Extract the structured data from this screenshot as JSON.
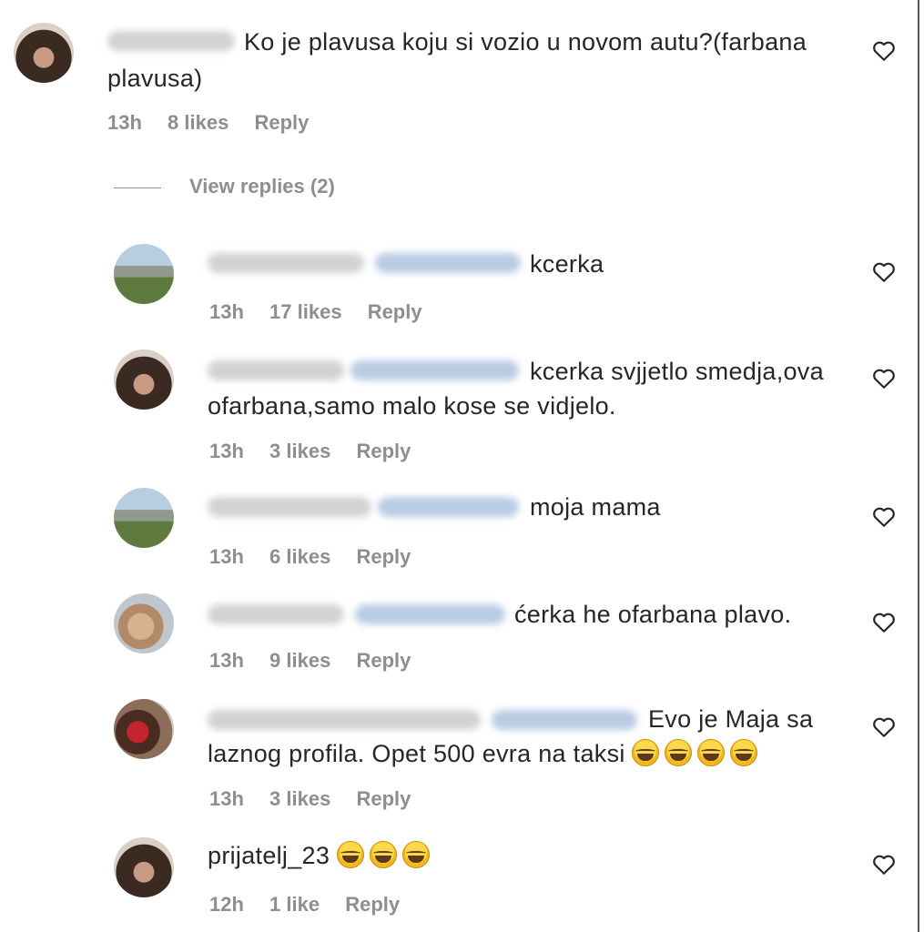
{
  "comments": [
    {
      "text_lines": [
        "Ko je plavusa koju si vozio u novom autu?(farbana",
        "plavusa)"
      ],
      "time": "13h",
      "likes": "8 likes",
      "reply": "Reply",
      "view_replies": "View replies (2)"
    },
    {
      "text_lines": [
        "kcerka"
      ],
      "time": "13h",
      "likes": "17 likes",
      "reply": "Reply"
    },
    {
      "text_lines": [
        "kcerka svjjetlo smedja,ova",
        "ofarbana,samo malo kose se vidjelo."
      ],
      "time": "13h",
      "likes": "3 likes",
      "reply": "Reply"
    },
    {
      "text_lines": [
        "moja mama"
      ],
      "time": "13h",
      "likes": "6 likes",
      "reply": "Reply"
    },
    {
      "text_lines": [
        "ćerka he ofarbana plavo."
      ],
      "time": "13h",
      "likes": "9 likes",
      "reply": "Reply"
    },
    {
      "text_lines": [
        "Evo je Maja sa",
        "laznog profila. Opet 500 evra na taksi"
      ],
      "emoji": "😂",
      "time": "13h",
      "likes": "3 likes",
      "reply": "Reply"
    },
    {
      "username": "prijatelj_23",
      "emoji": "😂",
      "time": "12h",
      "likes": "1 like",
      "reply": "Reply"
    }
  ],
  "icons": {
    "like": "heart-outline-icon",
    "laugh": "face-with-tears-of-joy-icon"
  }
}
